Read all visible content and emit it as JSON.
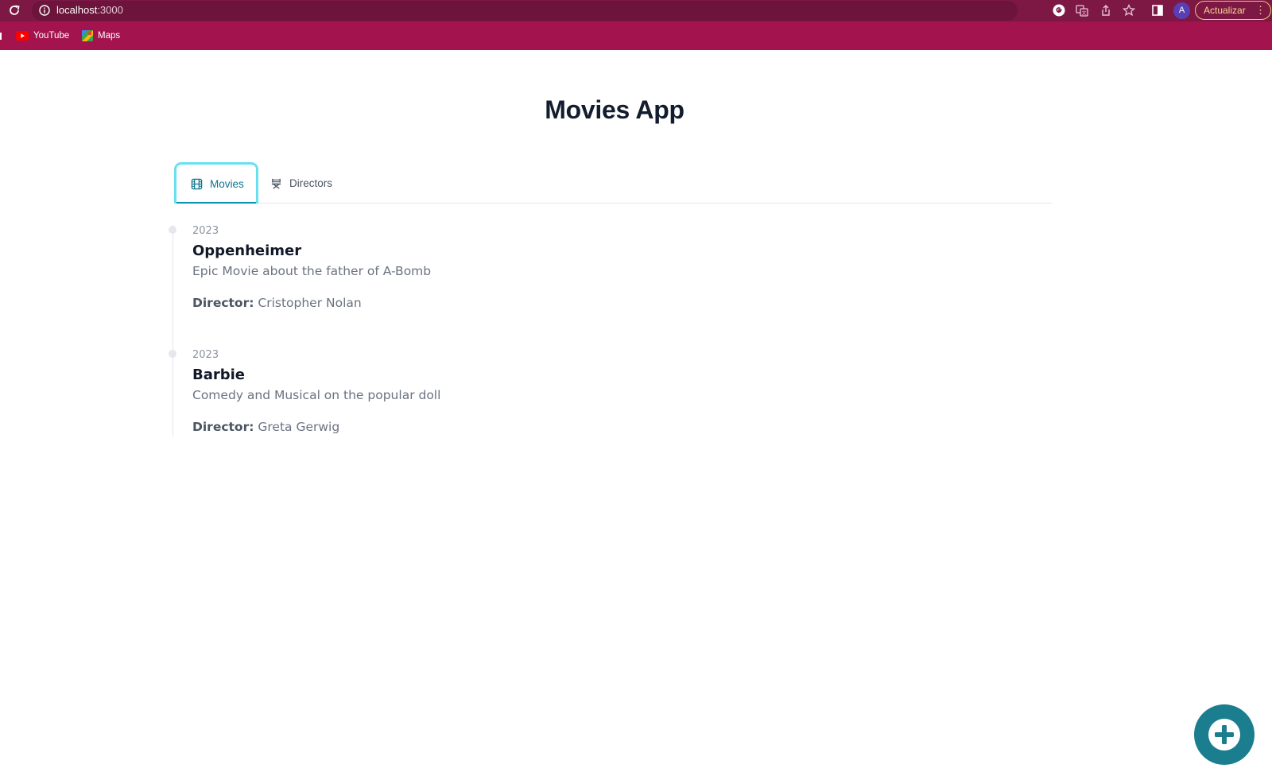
{
  "browser": {
    "url_host": "localhost",
    "url_port": ":3000",
    "profile_initial": "A",
    "update_label": "Actualizar",
    "menu_glyph": "⋮",
    "toolbar_icons": [
      "google-icon",
      "translate-icon",
      "share-icon",
      "star-icon",
      "sidebar-icon"
    ],
    "bookmarks": [
      {
        "label": "YouTube",
        "icon": "youtube-icon"
      },
      {
        "label": "Maps",
        "icon": "maps-icon"
      }
    ]
  },
  "page": {
    "title": "Movies App",
    "tabs": [
      {
        "label": "Movies",
        "icon": "film-icon",
        "active": true
      },
      {
        "label": "Directors",
        "icon": "director-chair-icon",
        "active": false
      }
    ],
    "director_label": "Director:",
    "movies": [
      {
        "year": "2023",
        "title": "Oppenheimer",
        "description": "Epic Movie about the father of A-Bomb",
        "director": "Cristopher Nolan"
      },
      {
        "year": "2023",
        "title": "Barbie",
        "description": "Comedy and Musical on the popular doll",
        "director": "Greta Gerwig"
      }
    ],
    "fab_icon": "plus-circle-icon"
  },
  "colors": {
    "browser_toolbar": "#7d1845",
    "bookmarks_bar": "#a3134d",
    "accent": "#0891b2",
    "tab_focus_ring": "#67e1ef",
    "fab": "#1a7e8e"
  }
}
